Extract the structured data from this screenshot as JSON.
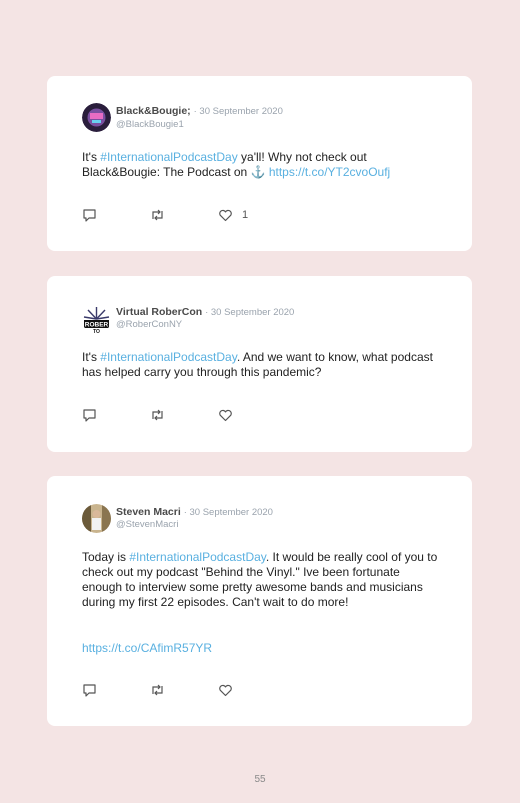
{
  "tweets": [
    {
      "name": "Black&Bougie;",
      "date": "· 30 September 2020",
      "handle": "@BlackBougie1",
      "text": [
        "It's ",
        "#InternationalPodcastDay",
        " ya'll! Why not check out Black&Bougie: The Podcast on ⚓ ",
        "https://t.co/YT2cvoOufj"
      ],
      "likes": "1"
    },
    {
      "name": "Virtual RoberCon",
      "date": "· 30 September 2020",
      "handle": "@RoberConNY",
      "text": [
        "It's ",
        "#InternationalPodcastDay",
        ". And we want to know, what podcast has helped carry you through this pandemic?"
      ],
      "likes": ""
    },
    {
      "name": "Steven Macri",
      "date": "· 30 September 2020",
      "handle": "@StevenMacri",
      "text": [
        "Today is ",
        "#InternationalPodcastDay",
        ". It would be really cool of you to check out my podcast \"Behind the Vinyl.\" Ive been fortunate enough to interview some pretty awesome bands and musicians during my first 22 episodes. Can't wait to do more!"
      ],
      "link": "https://t.co/CAfimR57YR",
      "likes": ""
    }
  ],
  "page_number": "55",
  "colors": {
    "background": "#f4e4e4",
    "hashtag": "#59b0e0"
  },
  "icons": {
    "reply": "reply-icon",
    "retweet": "retweet-icon",
    "like": "heart-icon"
  }
}
